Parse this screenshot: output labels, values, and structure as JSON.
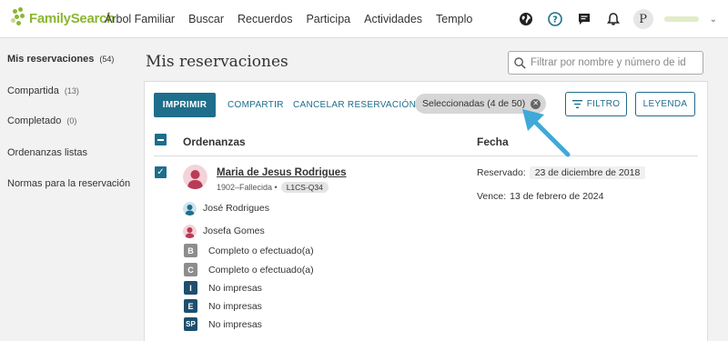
{
  "header": {
    "logo_text": "FamilySearch",
    "nav": [
      "Árbol Familiar",
      "Buscar",
      "Recuerdos",
      "Participa",
      "Actividades",
      "Templo"
    ],
    "avatar_letter": "P",
    "icons": [
      "globe-icon",
      "help-icon",
      "chat-icon",
      "bell-icon"
    ]
  },
  "sidebar": {
    "items": [
      {
        "label": "Mis reservaciones",
        "count": "(54)"
      },
      {
        "label": "Compartida",
        "count": "(13)"
      },
      {
        "label": "Completado",
        "count": "(0)"
      },
      {
        "label": "Ordenanzas listas",
        "count": ""
      },
      {
        "label": "Normas para la reservación",
        "count": ""
      }
    ]
  },
  "main": {
    "title": "Mis reservaciones",
    "search_placeholder": "Filtrar por nombre y número de id",
    "toolbar": {
      "print": "IMPRIMIR",
      "share": "COMPARTIR",
      "cancel": "CANCELAR RESERVACIÓN",
      "selected": "Seleccionadas (4 de 50)",
      "filter": "FILTRO",
      "legend": "LEYENDA"
    },
    "columns": {
      "ordinances": "Ordenanzas",
      "date": "Fecha"
    },
    "record": {
      "name": "Maria de Jesus Rodrigues",
      "meta": "1902–Fallecida •",
      "pid": "L1CS-Q34",
      "father": "José Rodrigues",
      "mother": "Josefa Gomes",
      "ordinances": [
        {
          "code": "B",
          "status": "Completo o efectuado(a)",
          "state": "done"
        },
        {
          "code": "C",
          "status": "Completo o efectuado(a)",
          "state": "done"
        },
        {
          "code": "I",
          "status": "No impresas",
          "state": "pending"
        },
        {
          "code": "E",
          "status": "No impresas",
          "state": "pending"
        },
        {
          "code": "SP",
          "status": "No impresas",
          "state": "pending"
        }
      ],
      "reserved_label": "Reservado:",
      "reserved_date": "23 de diciembre de 2018",
      "expires_label": "Vence:",
      "expires_date": "13 de febrero de 2024"
    }
  },
  "colors": {
    "accent": "#1e6e8c",
    "brand": "#8bb634",
    "arrow": "#3fa9d8"
  }
}
